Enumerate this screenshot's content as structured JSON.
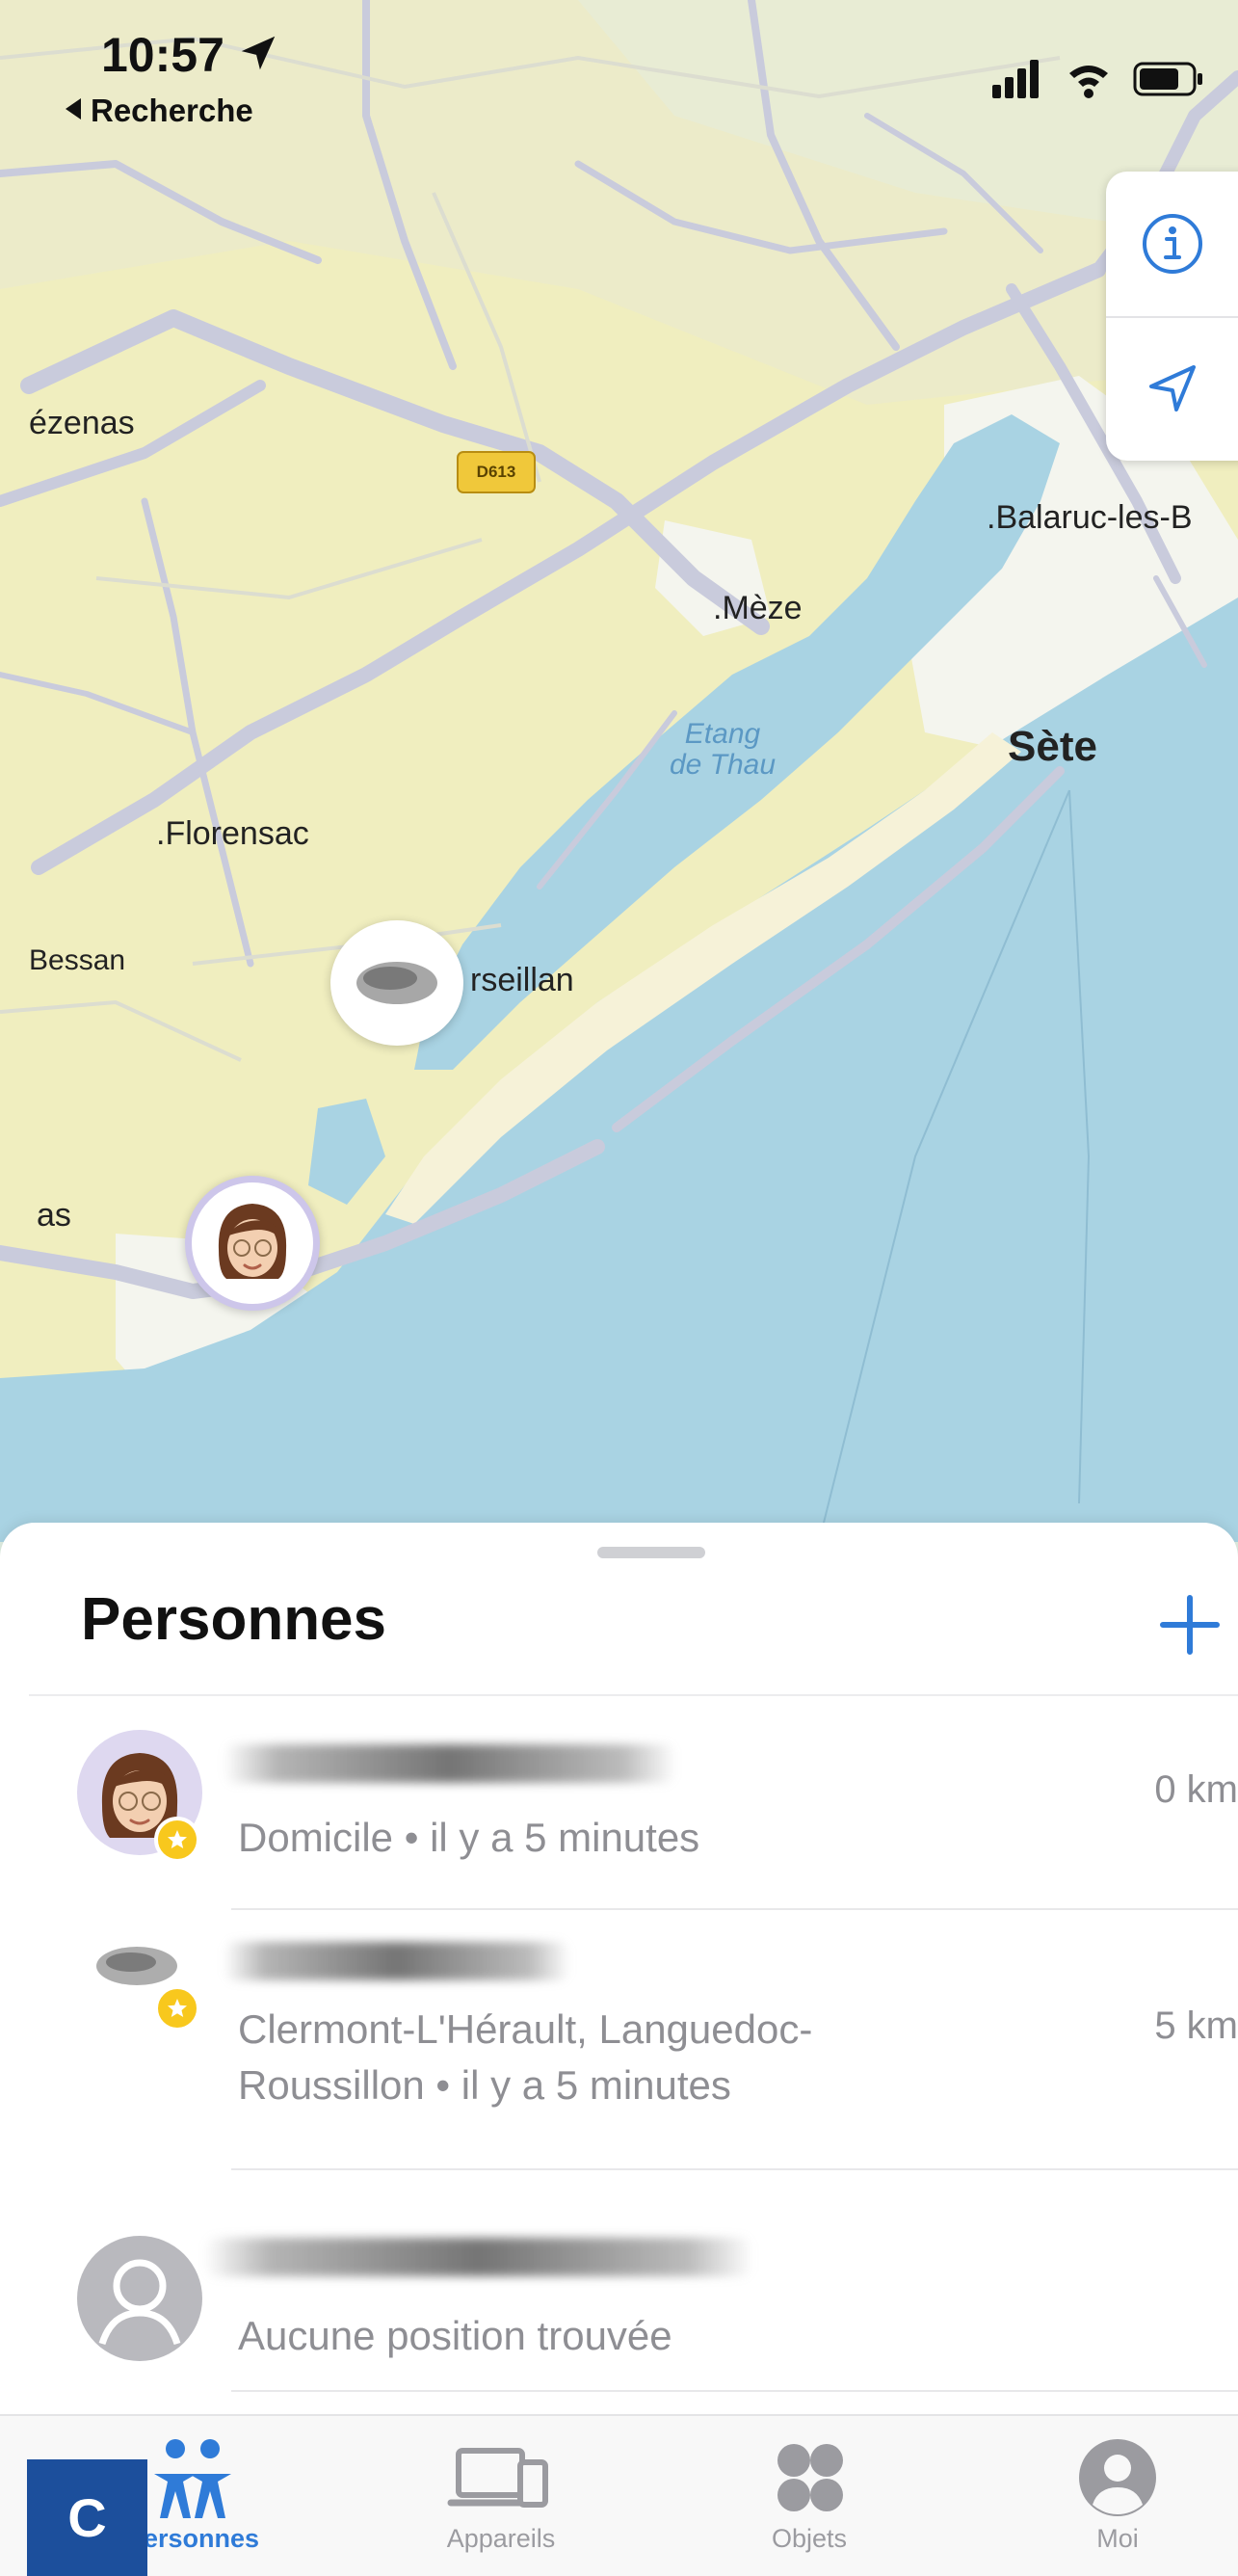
{
  "status_bar": {
    "time": "10:57",
    "back_label": "Recherche",
    "icons": [
      "signal-icon",
      "wifi-icon",
      "battery-icon"
    ]
  },
  "map": {
    "controls": [
      "info-icon",
      "location-arrow-icon"
    ],
    "road_badge": "D613",
    "labels": {
      "pezenas": "ézenas",
      "balaruc": ".Balaruc-les-B",
      "meze": ".Mèze",
      "etang_line1": "Etang",
      "etang_line2": "de Thau",
      "sete": "Sète",
      "florensac": ".Florensac",
      "bessan": "Bessan",
      "marseillan": "rseillan",
      "agde": "as"
    }
  },
  "sheet": {
    "title": "Personnes",
    "add_icon": "plus-icon",
    "people": [
      {
        "subtitle": "Domicile • il y a 5 minutes",
        "distance": "0 km",
        "favorite": true
      },
      {
        "subtitle_line1": "Clermont-L'Hérault, Languedoc-",
        "subtitle_line2": "Roussillon • il y a 5 minutes",
        "distance": "5 km",
        "favorite": true
      },
      {
        "subtitle": "Aucune position trouvée",
        "favorite": false
      }
    ]
  },
  "tabs": [
    {
      "label": "Personnes",
      "icon": "people-icon",
      "active": true
    },
    {
      "label": "Appareils",
      "icon": "devices-icon",
      "active": false
    },
    {
      "label": "Objets",
      "icon": "items-icon",
      "active": false
    },
    {
      "label": "Moi",
      "icon": "person-circle-icon",
      "active": false
    }
  ],
  "corner_badge": "C",
  "colors": {
    "accent": "#2f7bd8",
    "sea": "#a9d3e3",
    "land": "#f0eebf",
    "favorite": "#f8c81d"
  }
}
